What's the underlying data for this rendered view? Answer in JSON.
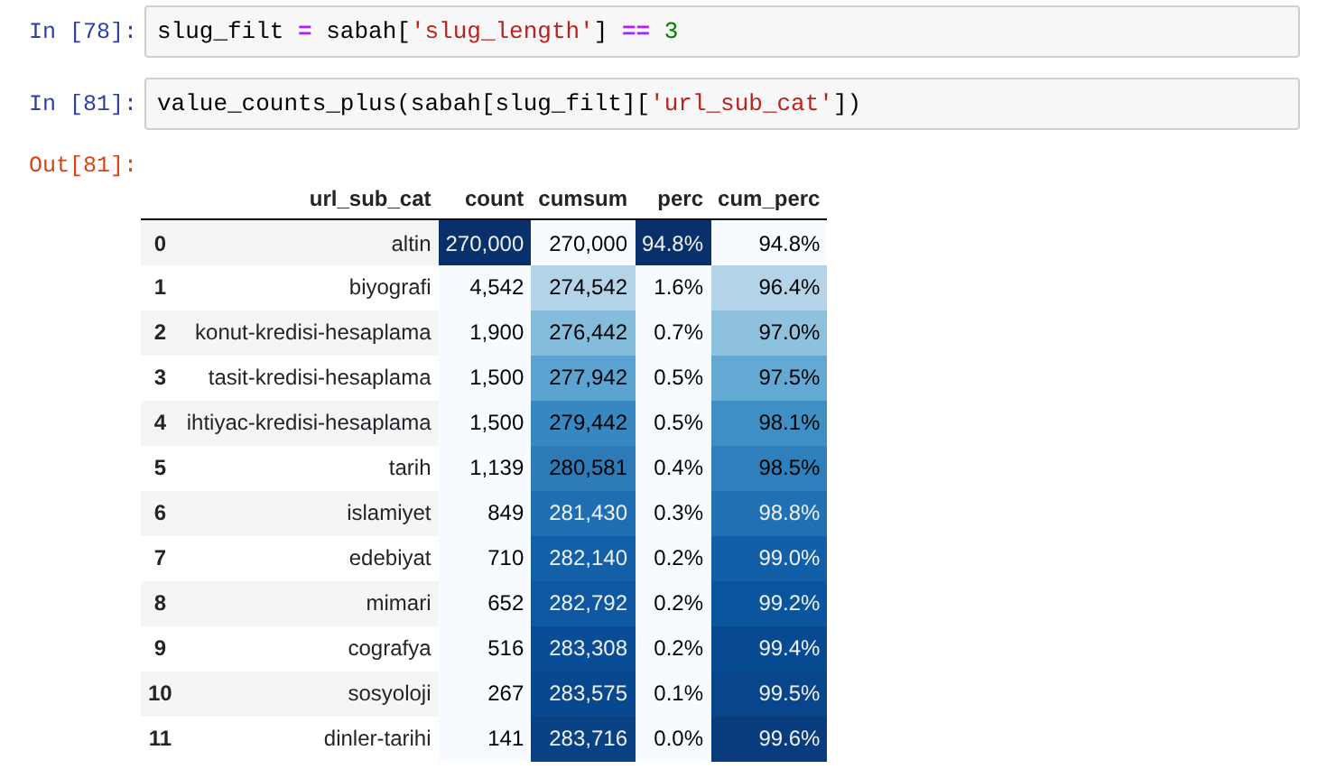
{
  "cells": [
    {
      "prompt": "In [78]:",
      "code": [
        {
          "kind": "plain",
          "text": "slug_filt "
        },
        {
          "kind": "op",
          "text": "="
        },
        {
          "kind": "plain",
          "text": " sabah["
        },
        {
          "kind": "string",
          "text": "'slug_length'"
        },
        {
          "kind": "plain",
          "text": "] "
        },
        {
          "kind": "op",
          "text": "=="
        },
        {
          "kind": "number",
          "text": " 3"
        }
      ]
    },
    {
      "prompt": "In [81]:",
      "code": [
        {
          "kind": "plain",
          "text": "value_counts_plus(sabah[slug_filt]["
        },
        {
          "kind": "string",
          "text": "'url_sub_cat'"
        },
        {
          "kind": "plain",
          "text": "])"
        }
      ]
    }
  ],
  "output": {
    "prompt": "Out[81]:",
    "table": {
      "columns": [
        "url_sub_cat",
        "count",
        "cumsum",
        "perc",
        "cum_perc"
      ],
      "rows": [
        {
          "index": "0",
          "cells": [
            {
              "text": "altin"
            },
            {
              "text": "270,000",
              "color": "#08306b"
            },
            {
              "text": "270,000",
              "color": "#f7fbff"
            },
            {
              "text": "94.8%",
              "color": "#08306b"
            },
            {
              "text": "94.8%",
              "color": "#f7fbff"
            }
          ]
        },
        {
          "index": "1",
          "cells": [
            {
              "text": "biyografi"
            },
            {
              "text": "4,542",
              "color": "#f7fbff"
            },
            {
              "text": "274,542",
              "color": "#b3d3e8"
            },
            {
              "text": "1.6%",
              "color": "#f7fbff"
            },
            {
              "text": "96.4%",
              "color": "#b3d3e8"
            }
          ]
        },
        {
          "index": "2",
          "cells": [
            {
              "text": "konut-kredisi-hesaplama"
            },
            {
              "text": "1,900",
              "color": "#f7fbff"
            },
            {
              "text": "276,442",
              "color": "#84bcdb"
            },
            {
              "text": "0.7%",
              "color": "#f7fbff"
            },
            {
              "text": "97.0%",
              "color": "#8dc1dd"
            }
          ]
        },
        {
          "index": "3",
          "cells": [
            {
              "text": "tasit-kredisi-hesaplama"
            },
            {
              "text": "1,500",
              "color": "#f7fbff"
            },
            {
              "text": "277,942",
              "color": "#5ba3d0"
            },
            {
              "text": "0.5%",
              "color": "#f7fbff"
            },
            {
              "text": "97.5%",
              "color": "#64a9d3"
            }
          ]
        },
        {
          "index": "4",
          "cells": [
            {
              "text": "ihtiyac-kredisi-hesaplama"
            },
            {
              "text": "1,500",
              "color": "#f7fbff"
            },
            {
              "text": "279,442",
              "color": "#3787c0"
            },
            {
              "text": "0.5%",
              "color": "#f7fbff"
            },
            {
              "text": "98.1%",
              "color": "#3f8fc5"
            }
          ]
        },
        {
          "index": "5",
          "cells": [
            {
              "text": "tarih"
            },
            {
              "text": "1,139",
              "color": "#f7fbff"
            },
            {
              "text": "280,581",
              "color": "#2c7bb6"
            },
            {
              "text": "0.4%",
              "color": "#f7fbff"
            },
            {
              "text": "98.5%",
              "color": "#2f7fbc"
            }
          ]
        },
        {
          "index": "6",
          "cells": [
            {
              "text": "islamiyet"
            },
            {
              "text": "849",
              "color": "#f7fbff"
            },
            {
              "text": "281,430",
              "color": "#1f6eb3"
            },
            {
              "text": "0.3%",
              "color": "#f7fbff"
            },
            {
              "text": "98.8%",
              "color": "#2070b4"
            }
          ]
        },
        {
          "index": "7",
          "cells": [
            {
              "text": "edebiyat"
            },
            {
              "text": "710",
              "color": "#f7fbff"
            },
            {
              "text": "282,140",
              "color": "#1460a8"
            },
            {
              "text": "0.2%",
              "color": "#f7fbff"
            },
            {
              "text": "99.0%",
              "color": "#135fa7"
            }
          ]
        },
        {
          "index": "8",
          "cells": [
            {
              "text": "mimari"
            },
            {
              "text": "652",
              "color": "#f7fbff"
            },
            {
              "text": "282,792",
              "color": "#0d58a1"
            },
            {
              "text": "0.2%",
              "color": "#f7fbff"
            },
            {
              "text": "99.2%",
              "color": "#0b559f"
            }
          ]
        },
        {
          "index": "9",
          "cells": [
            {
              "text": "cografya"
            },
            {
              "text": "516",
              "color": "#f7fbff"
            },
            {
              "text": "283,308",
              "color": "#084d96"
            },
            {
              "text": "0.2%",
              "color": "#f7fbff"
            },
            {
              "text": "99.4%",
              "color": "#084a91"
            }
          ]
        },
        {
          "index": "10",
          "cells": [
            {
              "text": "sosyoloji"
            },
            {
              "text": "267",
              "color": "#f7fbff"
            },
            {
              "text": "283,575",
              "color": "#08488e"
            },
            {
              "text": "0.1%",
              "color": "#f7fbff"
            },
            {
              "text": "99.5%",
              "color": "#08458a"
            }
          ]
        },
        {
          "index": "11",
          "cells": [
            {
              "text": "dinler-tarihi"
            },
            {
              "text": "141",
              "color": "#f7fbff"
            },
            {
              "text": "283,716",
              "color": "#084285"
            },
            {
              "text": "0.0%",
              "color": "#f7fbff"
            },
            {
              "text": "99.6%",
              "color": "#083c7d"
            }
          ]
        }
      ]
    }
  }
}
